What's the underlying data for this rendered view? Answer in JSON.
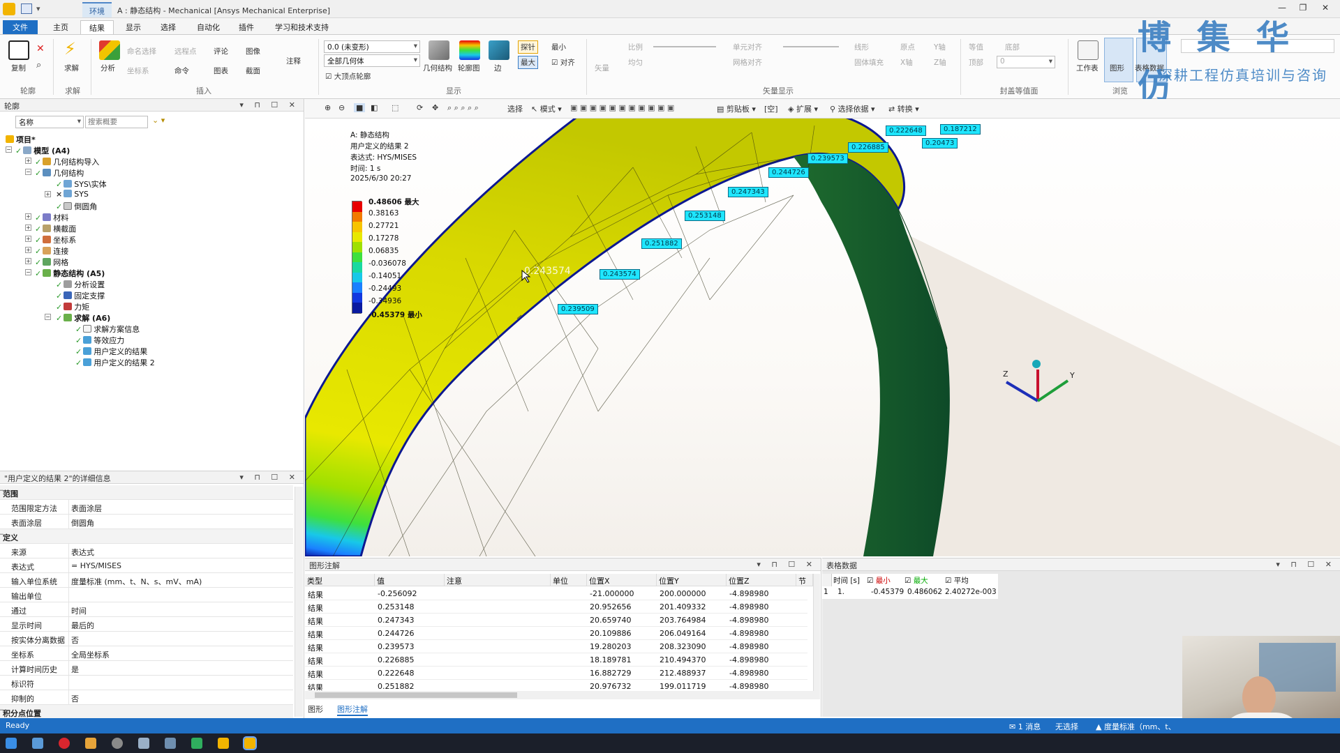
{
  "titlebar": {
    "context_tab": "环境",
    "title": "A : 静态结构 - Mechanical [Ansys Mechanical Enterprise]"
  },
  "ribbon_tabs": [
    "文件",
    "主页",
    "结果",
    "显示",
    "选择",
    "自动化",
    "插件",
    "学习和技术支持"
  ],
  "ribbon": {
    "groups": {
      "outline": "轮廓",
      "solve": "求解",
      "insert": "插入",
      "display": "显示",
      "vector": "矢量显示",
      "capped": "封盖等值面",
      "browse": "浏览"
    },
    "buttons": {
      "copy": "复制",
      "solve": "求解",
      "analysis": "分析",
      "named_sel": "命名选择",
      "remote_point": "远程点",
      "comment": "评论",
      "image": "图像",
      "annotation": "注释",
      "coord": "坐标系",
      "command": "命令",
      "chart": "图表",
      "section": "截面",
      "geometry": "几何结构",
      "contour": "轮廓图",
      "edges": "边",
      "probe": "探针",
      "min": "最小",
      "max": "最大",
      "align": "对齐",
      "vector": "矢量",
      "proportional": "比例",
      "uniform": "均匀",
      "elem_align": "单元对齐",
      "grid_align": "网格对齐",
      "line": "线形",
      "solid_fill": "固体填充",
      "origin": "原点",
      "x_axis": "X轴",
      "y_axis": "Y轴",
      "z_axis": "Z轴",
      "isoline": "等值",
      "bottom": "底部",
      "top": "顶部",
      "worksheet": "工作表",
      "graphics": "图形",
      "tabular": "表格数据"
    },
    "deform_combo": "0.0 (未变形)",
    "geometry_combo": "全部几何体",
    "top_value": "0",
    "max_outline_check": "大顶点轮廓"
  },
  "branding": {
    "title": "博 集 华 仿",
    "subtitle": "深耕工程仿真培训与咨询"
  },
  "outline": {
    "header": "轮廓",
    "name_combo": "名称",
    "search_placeholder": "搜索概要",
    "nodes": [
      "项目*",
      "模型 (A4)",
      "几何结构导入",
      "几何结构",
      "SYS\\实体",
      "SYS",
      "倒圆角",
      "材料",
      "横截面",
      "坐标系",
      "连接",
      "网格",
      "静态结构 (A5)",
      "分析设置",
      "固定支撑",
      "力矩",
      "求解 (A6)",
      "求解方案信息",
      "等效应力",
      "用户定义的结果",
      "用户定义的结果 2"
    ]
  },
  "details": {
    "header": "\"用户定义的结果 2\"的详细信息",
    "rows": [
      {
        "k": "范围",
        "v": "",
        "sec": true
      },
      {
        "k": "范围限定方法",
        "v": "表面涂层"
      },
      {
        "k": "表面涂层",
        "v": "倒圆角"
      },
      {
        "k": "定义",
        "v": "",
        "sec": true
      },
      {
        "k": "来源",
        "v": "表达式"
      },
      {
        "k": "表达式",
        "v": "= HYS/MISES"
      },
      {
        "k": "输入单位系统",
        "v": "度量标准 (mm、t、N、s、mV、mA)"
      },
      {
        "k": "输出单位",
        "v": ""
      },
      {
        "k": "通过",
        "v": "时间"
      },
      {
        "k": "显示时间",
        "v": "最后的"
      },
      {
        "k": "按实体分离数据",
        "v": "否"
      },
      {
        "k": "坐标系",
        "v": "全局坐标系"
      },
      {
        "k": "计算时间历史",
        "v": "是"
      },
      {
        "k": "标识符",
        "v": ""
      },
      {
        "k": "抑制的",
        "v": "否"
      },
      {
        "k": "积分点位置",
        "v": "",
        "sec": true
      }
    ]
  },
  "view_toolbar": {
    "select": "选择",
    "mode": "模式",
    "clipboard": "剪贴板",
    "empty": "[空]",
    "extend": "扩展",
    "select_by": "选择依据",
    "convert": "转换"
  },
  "legend": {
    "title": "A: 静态结构",
    "subtitle": "用户定义的结果 2",
    "expression": "表达式: HYS/MISES",
    "time": "时间: 1 s",
    "date": "2025/6/30 20:27",
    "max_label": "0.48606 最大",
    "min_label": "-0.45379 最小",
    "values": [
      "0.38163",
      "0.27721",
      "0.17278",
      "0.06835",
      "-0.036078",
      "-0.14051",
      "-0.24493",
      "-0.34936"
    ],
    "colors": [
      "#e80000",
      "#f27a00",
      "#f7c400",
      "#e8e800",
      "#9fe000",
      "#3ee03e",
      "#19d9a0",
      "#18c8e8",
      "#1a80ff",
      "#1238e0",
      "#0a1aa0"
    ]
  },
  "probes": {
    "cursor_value": "0.243574",
    "tags": [
      "0.239509",
      "0.243574",
      "0.251882",
      "0.253148",
      "0.247343",
      "0.244726",
      "0.239573",
      "0.226885",
      "0.222648",
      "0.20473",
      "0.187212"
    ]
  },
  "annotation_table": {
    "header": "图形注解",
    "columns": [
      "类型",
      "值",
      "注意",
      "单位",
      "位置X",
      "位置Y",
      "位置Z",
      "节点"
    ],
    "rows": [
      [
        "结果",
        "-0.256092",
        "",
        "",
        "-21.000000",
        "200.000000",
        "-4.898980"
      ],
      [
        "结果",
        "0.253148",
        "",
        "",
        "20.952656",
        "201.409332",
        "-4.898980"
      ],
      [
        "结果",
        "0.247343",
        "",
        "",
        "20.659740",
        "203.764984",
        "-4.898980"
      ],
      [
        "结果",
        "0.244726",
        "",
        "",
        "20.109886",
        "206.049164",
        "-4.898980"
      ],
      [
        "结果",
        "0.239573",
        "",
        "",
        "19.280203",
        "208.323090",
        "-4.898980"
      ],
      [
        "结果",
        "0.226885",
        "",
        "",
        "18.189781",
        "210.494370",
        "-4.898980"
      ],
      [
        "结果",
        "0.222648",
        "",
        "",
        "16.882729",
        "212.488937",
        "-4.898980"
      ],
      [
        "结果",
        "0.251882",
        "",
        "",
        "20.976732",
        "199.011719",
        "-4.898980"
      ]
    ],
    "tabs": [
      "图形",
      "图形注解"
    ]
  },
  "tabular": {
    "header": "表格数据",
    "columns": [
      "时间 [s]",
      "最小",
      "最大",
      "平均"
    ],
    "row": [
      "1",
      "1.",
      "-0.45379",
      "0.486062",
      "2.40272e-003"
    ]
  },
  "status": {
    "ready": "Ready",
    "messages": "1 消息",
    "selection": "无选择",
    "units": "度量标准（mm、t、"
  },
  "colors": {
    "accent": "#1f6fc4",
    "probe": "#1fe6ff"
  }
}
